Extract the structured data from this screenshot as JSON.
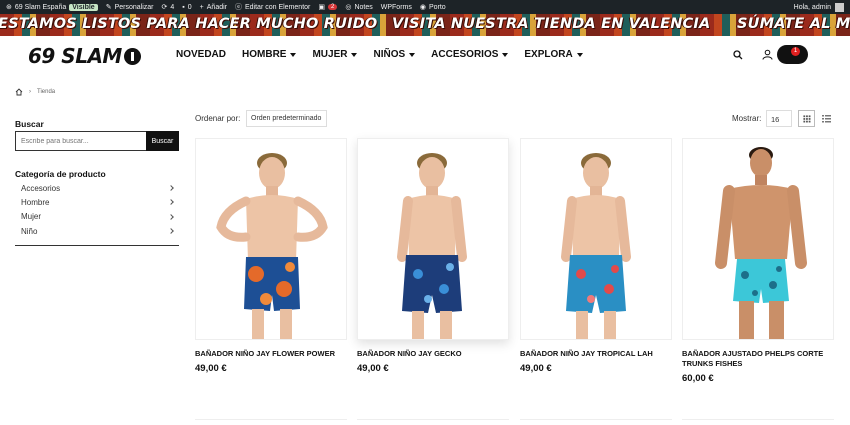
{
  "admin_bar": {
    "site": "69 Slam España",
    "visible_badge": "Visible",
    "customize": "Personalizar",
    "updates": "4",
    "comments": "0",
    "add_new": "Añadir",
    "elementor": "Editar con Elementor",
    "woo_count": "2",
    "notes": "Notes",
    "wpforms": "WPForms",
    "porto": "Porto",
    "greeting": "Hola, admin"
  },
  "banner": {
    "items": [
      "ESTAMOS LISTOS PARA HACER MUCHO RUIDO",
      "VISITA NUESTRA TIENDA EN VALENCIA",
      "SÚMATE AL MOVIMI"
    ]
  },
  "header": {
    "logo": "69 SLAM",
    "nav": [
      "NOVEDAD",
      "HOMBRE",
      "MUJER",
      "NIÑOS",
      "ACCESORIOS",
      "EXPLORA"
    ],
    "cart_count": "1"
  },
  "breadcrumb": {
    "current": "Tienda"
  },
  "sidebar": {
    "search_title": "Buscar",
    "search_placeholder": "Escribe para buscar...",
    "search_button": "Buscar",
    "categories_title": "Categoría de producto",
    "categories": [
      "Accesorios",
      "Hombre",
      "Mujer",
      "Niño"
    ]
  },
  "toolbar": {
    "orderby_label": "Ordenar por:",
    "orderby_value": "Orden predeterminado",
    "show_label": "Mostrar:",
    "show_value": "16"
  },
  "products": [
    {
      "name": "BAÑADOR NIÑO JAY FLOWER POWER",
      "price": "49,00 €"
    },
    {
      "name": "BAÑADOR NIÑO JAY GECKO",
      "price": "49,00 €"
    },
    {
      "name": "BAÑADOR NIÑO JAY TROPICAL LAH",
      "price": "49,00 €"
    },
    {
      "name": "BAÑADOR AJUSTADO PHELPS CORTE TRUNKS FISHES",
      "price": "60,00 €"
    }
  ],
  "colors": {
    "admin_bar": "#1d2327",
    "accent_red": "#e02020",
    "swim_orange_blue": "#e46a2a",
    "swim_navy": "#1d3d7a",
    "swim_teal": "#2a8fc4",
    "swim_cyan": "#3cc7d8"
  }
}
